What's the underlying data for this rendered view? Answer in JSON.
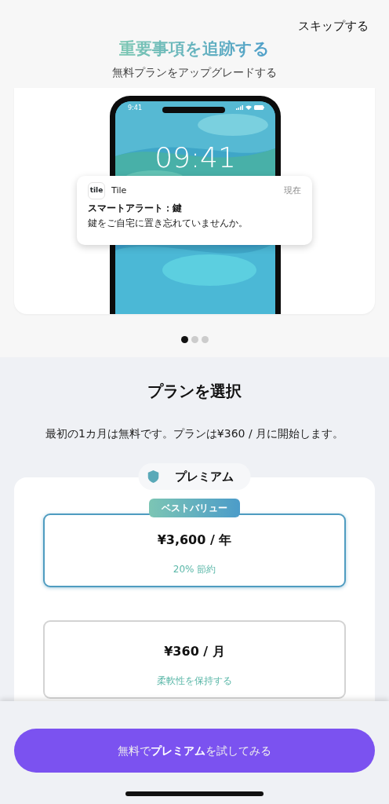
{
  "skip_button": "スキップする",
  "header": {
    "title": "重要事項を追跡する",
    "subtitle": "無料プランをアップグレードする"
  },
  "illustration": {
    "phone": {
      "status_time": "9:41",
      "clock": "09:41"
    },
    "notification": {
      "app_icon_text": "tile",
      "app_name": "Tile",
      "time": "現在",
      "title": "スマートアラート：鍵",
      "body": "鍵をご自宅に置き忘れていませんか。"
    }
  },
  "carousel_dots": [
    {
      "selected": true
    },
    {
      "selected": false
    },
    {
      "selected": false
    }
  ],
  "plan_section": {
    "title": "プランを選択",
    "description": "最初の1カ月は無料です。プランは¥360 / 月に開始します。",
    "tier": "プレミアム",
    "options": [
      {
        "badge": "ベストバリュー",
        "price": "¥3,600 / 年",
        "note": "20% 節約",
        "selected": true
      },
      {
        "price": "¥360 / 月",
        "note": "柔軟性を保持する",
        "selected": false
      }
    ]
  },
  "cta_button": "無料で**プレミアム**を試してみる"
}
